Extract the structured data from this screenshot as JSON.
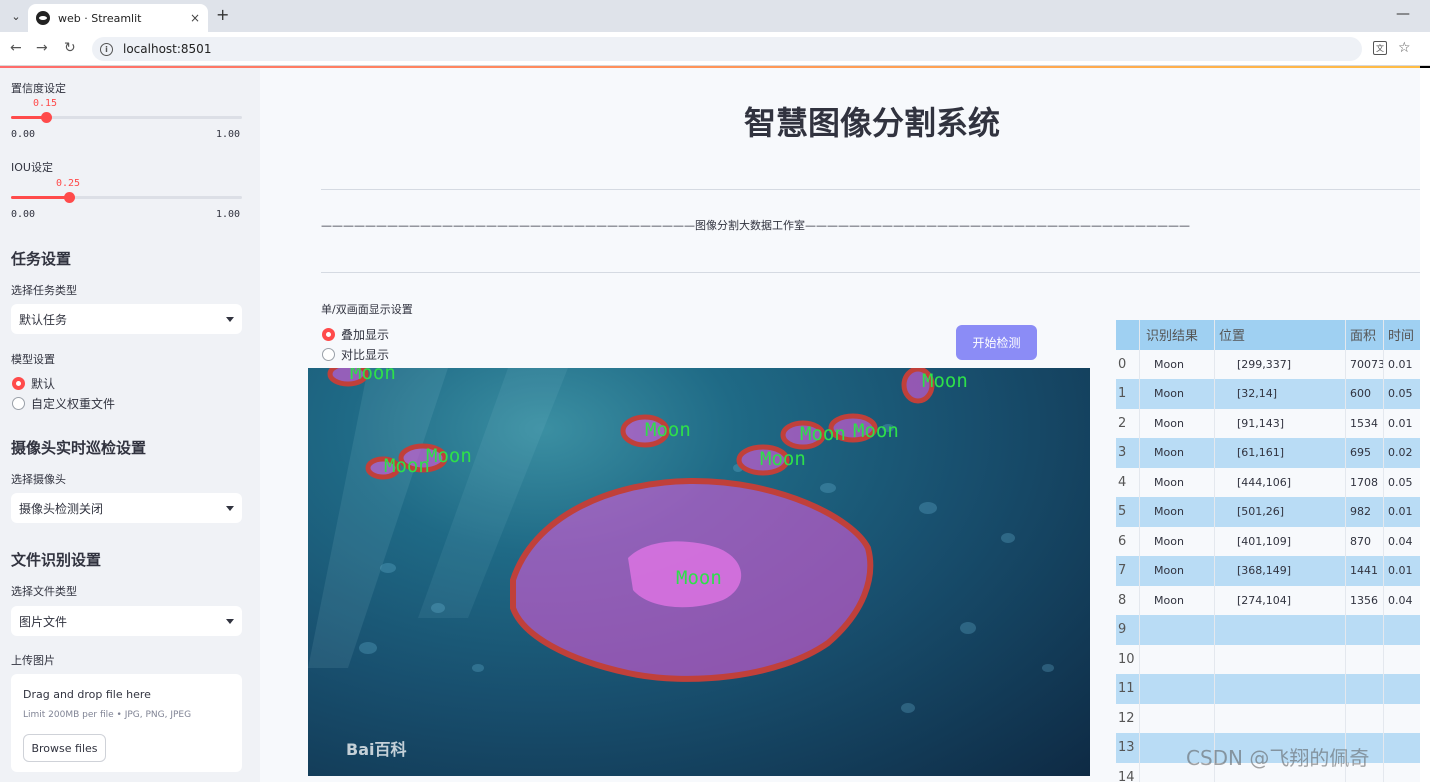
{
  "browser": {
    "tab_title": "web · Streamlit",
    "tab_close": "×",
    "new_tab": "+",
    "url": "localhost:8501"
  },
  "sidebar": {
    "confidence": {
      "label": "置信度设定",
      "value": "0.15",
      "value_num": 0.15,
      "min": "0.00",
      "max": "1.00"
    },
    "iou": {
      "label": "IOU设定",
      "value": "0.25",
      "value_num": 0.25,
      "min": "0.00",
      "max": "1.00"
    },
    "task_section": "任务设置",
    "task_type_label": "选择任务类型",
    "task_type_value": "默认任务",
    "model_label": "模型设置",
    "model_options": [
      "默认",
      "自定义权重文件"
    ],
    "camera_section": "摄像头实时巡检设置",
    "camera_label": "选择摄像头",
    "camera_value": "摄像头检测关闭",
    "file_section": "文件识别设置",
    "file_type_label": "选择文件类型",
    "file_type_value": "图片文件",
    "upload_label": "上传图片",
    "upload_title": "Drag and drop file here",
    "upload_limit": "Limit 200MB per file • JPG, PNG, JPEG",
    "browse_label": "Browse files"
  },
  "main": {
    "title": "智慧图像分割系统",
    "subtitle": "——————————————————————————————————图像分割大数据工作室———————————————————————————————————",
    "display_label": "单/双画面显示设置",
    "display_options": [
      "叠加显示",
      "对比显示"
    ],
    "detect_button": "开始检测",
    "image_watermark": "Bai百科"
  },
  "detections": {
    "label": "Moon",
    "color_mask": "#d65ad6",
    "color_outline": "#c0403a",
    "color_text": "#2ee04a"
  },
  "table": {
    "headers": [
      "",
      "识别结果",
      "位置",
      "面积",
      "时间"
    ],
    "rows": [
      [
        "0",
        "Moon",
        "[299,337]",
        "70073",
        "0.01"
      ],
      [
        "1",
        "Moon",
        "[32,14]",
        "600",
        "0.05"
      ],
      [
        "2",
        "Moon",
        "[91,143]",
        "1534",
        "0.01"
      ],
      [
        "3",
        "Moon",
        "[61,161]",
        "695",
        "0.02"
      ],
      [
        "4",
        "Moon",
        "[444,106]",
        "1708",
        "0.05"
      ],
      [
        "5",
        "Moon",
        "[501,26]",
        "982",
        "0.01"
      ],
      [
        "6",
        "Moon",
        "[401,109]",
        "870",
        "0.04"
      ],
      [
        "7",
        "Moon",
        "[368,149]",
        "1441",
        "0.01"
      ],
      [
        "8",
        "Moon",
        "[274,104]",
        "1356",
        "0.04"
      ],
      [
        "9",
        "",
        "",
        "",
        ""
      ],
      [
        "10",
        "",
        "",
        "",
        ""
      ],
      [
        "11",
        "",
        "",
        "",
        ""
      ],
      [
        "12",
        "",
        "",
        "",
        ""
      ],
      [
        "13",
        "",
        "",
        "",
        ""
      ],
      [
        "14",
        "",
        "",
        "",
        ""
      ]
    ]
  },
  "watermark": "CSDN @飞翔的佩奇"
}
